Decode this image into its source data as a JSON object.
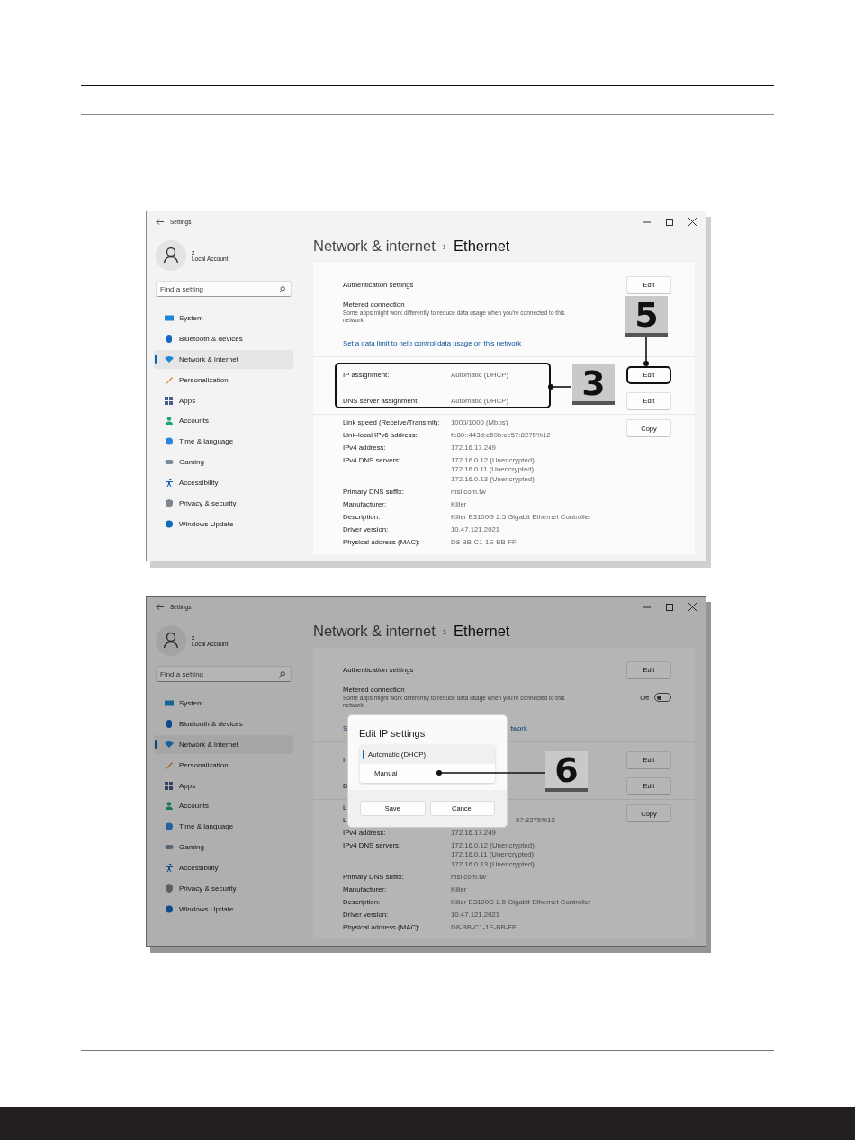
{
  "screenshots": [
    {
      "dimmed": false,
      "title": "Settings",
      "user": {
        "name": "z",
        "account": "Local Account"
      },
      "search": {
        "placeholder": "Find a setting"
      },
      "nav": [
        {
          "label": "System",
          "selected": false
        },
        {
          "label": "Bluetooth & devices",
          "selected": false
        },
        {
          "label": "Network & internet",
          "selected": true
        },
        {
          "label": "Personalization",
          "selected": false
        },
        {
          "label": "Apps",
          "selected": false
        },
        {
          "label": "Accounts",
          "selected": false
        },
        {
          "label": "Time & language",
          "selected": false
        },
        {
          "label": "Gaming",
          "selected": false
        },
        {
          "label": "Accessibility",
          "selected": false
        },
        {
          "label": "Privacy & security",
          "selected": false
        },
        {
          "label": "Windows Update",
          "selected": false
        }
      ],
      "breadcrumb": {
        "parent": "Network & internet",
        "separator": "›",
        "current": "Ethernet"
      },
      "auth": {
        "label": "Authentication settings",
        "button": "Edit"
      },
      "metered": {
        "title": "Metered connection",
        "description": "Some apps might work differently to reduce data usage when you're connected to this network"
      },
      "link": [
        "Set a data limit to help control data usage on this network"
      ],
      "assignments": [
        {
          "label": "IP assignment:",
          "value": "Automatic (DHCP)",
          "button": "Edit",
          "highlighted": true
        },
        {
          "label": "DNS server assignment:",
          "value": "Automatic (DHCP)",
          "button": "Edit",
          "highlighted": false
        }
      ],
      "copy_button": "Copy",
      "details": [
        {
          "kind": "full",
          "label": "Link speed (Receive/Transmit):",
          "values": [
            "1000/1000 (Mbps)"
          ]
        },
        {
          "kind": "full",
          "label": "Link-local IPv6 address:",
          "values": [
            "fe80::443d:e59b:ce57:8275%12"
          ]
        },
        {
          "kind": "full",
          "label": "IPv4 address:",
          "values": [
            "172.16.17.249"
          ]
        },
        {
          "kind": "full",
          "label": "IPv4 DNS servers:",
          "values": [
            "172.16.0.12 (Unencrypted)",
            "172.16.0.11 (Unencrypted)",
            "172.16.0.13 (Unencrypted)"
          ]
        },
        {
          "kind": "full",
          "label": "Primary DNS suffix:",
          "values": [
            "msi.com.tw"
          ]
        },
        {
          "kind": "full",
          "label": "Manufacturer:",
          "values": [
            "Killer"
          ]
        },
        {
          "kind": "full",
          "label": "Description:",
          "values": [
            "Killer E3100G 2.5 Gigabit Ethernet Controller"
          ]
        },
        {
          "kind": "full",
          "label": "Driver version:",
          "values": [
            "10.47.121.2021"
          ]
        },
        {
          "kind": "full",
          "label": "Physical address (MAC):",
          "values": [
            "D8-BB-C1-1E-BB-FF"
          ]
        }
      ],
      "callouts": [
        {
          "number": "5",
          "kind": "button"
        },
        {
          "number": "3",
          "kind": "bracket"
        }
      ]
    },
    {
      "dimmed": true,
      "title": "Settings",
      "user": {
        "name": "z",
        "account": "Local Account"
      },
      "search": {
        "placeholder": "Find a setting"
      },
      "nav": [
        {
          "label": "System",
          "selected": false
        },
        {
          "label": "Bluetooth & devices",
          "selected": false
        },
        {
          "label": "Network & internet",
          "selected": true
        },
        {
          "label": "Personalization",
          "selected": false
        },
        {
          "label": "Apps",
          "selected": false
        },
        {
          "label": "Accounts",
          "selected": false
        },
        {
          "label": "Time & language",
          "selected": false
        },
        {
          "label": "Gaming",
          "selected": false
        },
        {
          "label": "Accessibility",
          "selected": false
        },
        {
          "label": "Privacy & security",
          "selected": false
        },
        {
          "label": "Windows Update",
          "selected": false
        }
      ],
      "breadcrumb": {
        "parent": "Network & internet",
        "separator": "›",
        "current": "Ethernet"
      },
      "auth": {
        "label": "Authentication settings",
        "button": "Edit"
      },
      "metered": {
        "title": "Metered connection",
        "description": "Some apps might work differently to reduce data usage when you're connected to this network",
        "toggle": {
          "label": "Off",
          "on": false
        }
      },
      "link": [
        "S",
        "twork"
      ],
      "assignments": [
        {
          "label": "I",
          "button": "Edit",
          "highlighted": false
        },
        {
          "label": "D",
          "button": "Edit",
          "highlighted": false
        }
      ],
      "copy_button": "Copy",
      "details": [
        {
          "kind": "clipped",
          "label": "L"
        },
        {
          "kind": "clipped",
          "label": "L",
          "values": [
            "57:8275%12"
          ]
        },
        {
          "kind": "full",
          "label": "IPv4 address:",
          "values": [
            "172.16.17.249"
          ]
        },
        {
          "kind": "full",
          "label": "IPv4 DNS servers:",
          "values": [
            "172.16.0.12 (Unencrypted)",
            "172.16.0.11 (Unencrypted)",
            "172.16.0.13 (Unencrypted)"
          ]
        },
        {
          "kind": "full",
          "label": "Primary DNS suffix:",
          "values": [
            "msi.com.tw"
          ]
        },
        {
          "kind": "full",
          "label": "Manufacturer:",
          "values": [
            "Killer"
          ]
        },
        {
          "kind": "full",
          "label": "Description:",
          "values": [
            "Killer E3100G 2.5 Gigabit Ethernet Controller"
          ]
        },
        {
          "kind": "full",
          "label": "Driver version:",
          "values": [
            "10.47.121.2021"
          ]
        },
        {
          "kind": "full",
          "label": "Physical address (MAC):",
          "values": [
            "D8-BB-C1-1E-BB-FF"
          ]
        }
      ],
      "dialog": {
        "title": "Edit IP settings",
        "options": [
          {
            "label": "Automatic (DHCP)",
            "selected": true
          },
          {
            "label": "Manual",
            "selected": false
          }
        ],
        "buttons": [
          "Save",
          "Cancel"
        ]
      },
      "callouts": [
        {
          "number": "6",
          "kind": "option"
        }
      ]
    }
  ]
}
